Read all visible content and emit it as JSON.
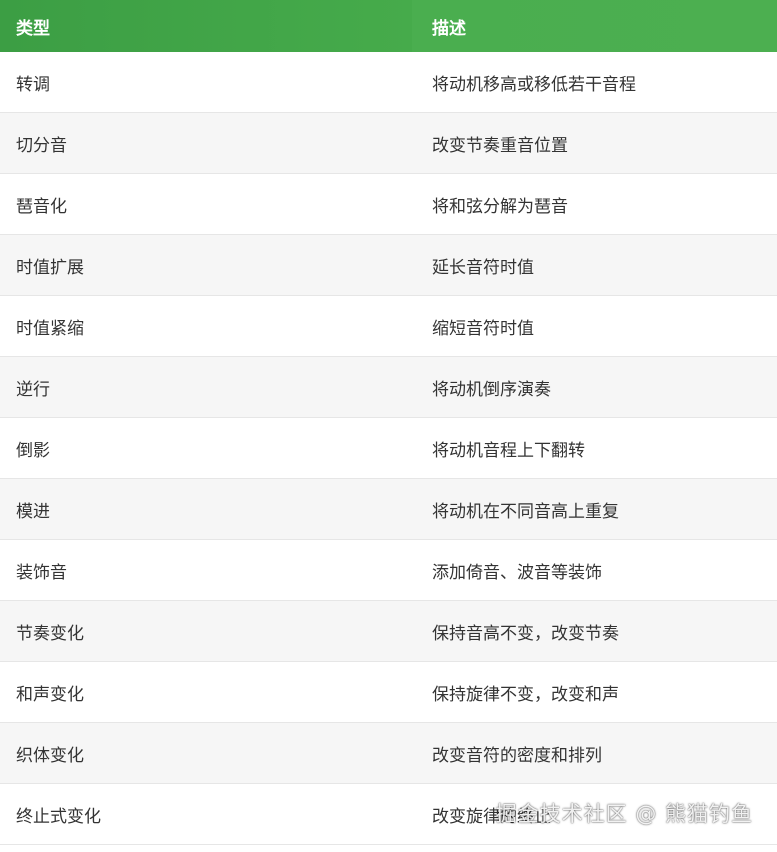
{
  "table": {
    "headers": [
      "类型",
      "描述"
    ],
    "rows": [
      {
        "type": "转调",
        "desc": "将动机移高或移低若干音程"
      },
      {
        "type": "切分音",
        "desc": "改变节奏重音位置"
      },
      {
        "type": "琶音化",
        "desc": "将和弦分解为琶音"
      },
      {
        "type": "时值扩展",
        "desc": "延长音符时值"
      },
      {
        "type": "时值紧缩",
        "desc": "缩短音符时值"
      },
      {
        "type": "逆行",
        "desc": "将动机倒序演奏"
      },
      {
        "type": "倒影",
        "desc": "将动机音程上下翻转"
      },
      {
        "type": "模进",
        "desc": "将动机在不同音高上重复"
      },
      {
        "type": "装饰音",
        "desc": "添加倚音、波音等装饰"
      },
      {
        "type": "节奏变化",
        "desc": "保持音高不变，改变节奏"
      },
      {
        "type": "和声变化",
        "desc": "保持旋律不变，改变和声"
      },
      {
        "type": "织体变化",
        "desc": "改变音符的密度和排列"
      },
      {
        "type": "终止式变化",
        "desc": "改变旋律的终止"
      }
    ]
  },
  "watermark": "掘金技术社区 @ 熊猫钓鱼"
}
